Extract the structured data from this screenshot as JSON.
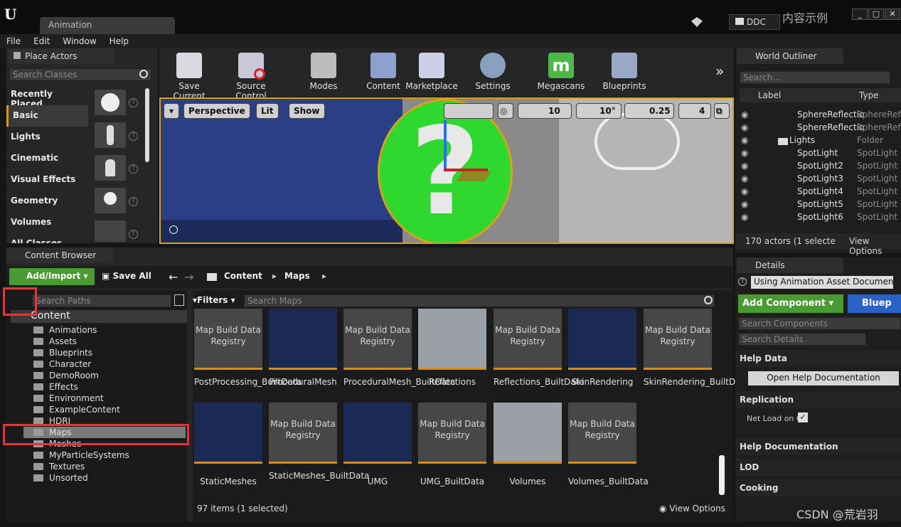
{
  "window": {
    "tab_title": "Animation",
    "ddc_label": "DDC",
    "example_label": "内容示例",
    "controls": [
      "_",
      "□",
      "✕"
    ]
  },
  "menu": [
    "File",
    "Edit",
    "Window",
    "Help"
  ],
  "place_actors": {
    "tab": "Place Actors",
    "search_placeholder": "Search Classes",
    "categories": [
      "Recently Placed",
      "Basic",
      "Lights",
      "Cinematic",
      "Visual Effects",
      "Geometry",
      "Volumes",
      "All Classes"
    ]
  },
  "toolbar": {
    "buttons": [
      "Save Current",
      "Source Control",
      "Modes",
      "Content",
      "Marketplace",
      "Settings",
      "Megascans",
      "Blueprints"
    ]
  },
  "viewport": {
    "perspective": "Perspective",
    "lit": "Lit",
    "show": "Show",
    "grid_snap": "10",
    "rot_snap": "10°",
    "scale_snap": "0.25",
    "camera_speed": "4"
  },
  "world_outliner": {
    "tab": "World Outliner",
    "search_placeholder": "Search...",
    "col_label": "Label",
    "col_type": "Type",
    "rows": [
      {
        "name": "SphereReflectio",
        "type": "SphereRefl"
      },
      {
        "name": "SphereReflectio",
        "type": "SphereRefl"
      },
      {
        "name": "Lights",
        "type": "Folder"
      },
      {
        "name": "SpotLight",
        "type": "SpotLight"
      },
      {
        "name": "SpotLight2",
        "type": "SpotLight"
      },
      {
        "name": "SpotLight3",
        "type": "SpotLight"
      },
      {
        "name": "SpotLight4",
        "type": "SpotLight"
      },
      {
        "name": "SpotLight5",
        "type": "SpotLight"
      },
      {
        "name": "SpotLight6",
        "type": "SpotLight"
      }
    ],
    "status": "170 actors (1 selecte",
    "view_options": "View Options"
  },
  "content_browser": {
    "tab": "Content Browser",
    "add_import": "Add/Import",
    "save_all": "Save All",
    "path": [
      "Content",
      "Maps"
    ],
    "search_paths_placeholder": "Search Paths",
    "filters": "Filters",
    "search_maps_placeholder": "Search Maps",
    "root_folder": "Content",
    "folders": [
      "Animations",
      "Assets",
      "Blueprints",
      "Character",
      "DemoRoom",
      "Effects",
      "Environment",
      "ExampleContent",
      "HDRI",
      "Maps",
      "Meshes",
      "MyParticleSystems",
      "Textures",
      "Unsorted"
    ],
    "assets": [
      {
        "name": "PostProcessing_BuiltData",
        "thumb": "Map Build Data Registry"
      },
      {
        "name": "ProceduralMesh",
        "thumb": ""
      },
      {
        "name": "ProceduralMesh_BuiltData",
        "thumb": "Map Build Data Registry"
      },
      {
        "name": "Reflections",
        "thumb": ""
      },
      {
        "name": "Reflections_BuiltData",
        "thumb": "Map Build Data Registry"
      },
      {
        "name": "SkinRendering",
        "thumb": ""
      },
      {
        "name": "SkinRendering_BuiltData",
        "thumb": "Map Build Data Registry"
      },
      {
        "name": "StaticMeshes",
        "thumb": ""
      },
      {
        "name": "StaticMeshes_BuiltData",
        "thumb": "Map Build Data Registry"
      },
      {
        "name": "UMG",
        "thumb": ""
      },
      {
        "name": "UMG_BuiltData",
        "thumb": "Map Build Data Registry"
      },
      {
        "name": "Volumes",
        "thumb": ""
      },
      {
        "name": "Volumes_BuiltData",
        "thumb": "Map Build Data Registry"
      }
    ],
    "status": "97 items (1 selected)",
    "view_options": "View Options"
  },
  "details": {
    "tab": "Details",
    "doc_link": "Using Animation Asset Documentat",
    "add_component": "Add Component",
    "blueprint": "Bluep",
    "search_components": "Search Components",
    "search_details": "Search Details",
    "sections": [
      "Help Data",
      "Replication",
      "Help Documentation",
      "LOD",
      "Cooking"
    ],
    "open_help": "Open Help Documentation",
    "net_load": "Net Load on C"
  },
  "watermark": "CSDN @荒岩羽"
}
